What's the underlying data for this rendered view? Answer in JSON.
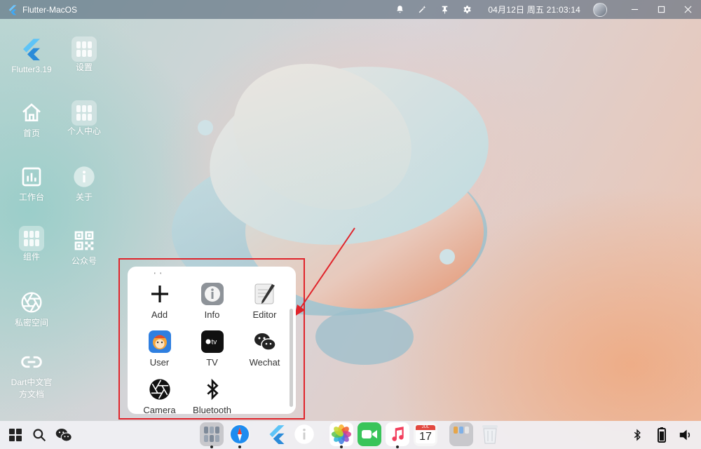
{
  "titlebar": {
    "app_title": "Flutter-MacOS",
    "clock": "04月12日 周五 21:03:14",
    "icons": [
      "bell-icon",
      "magic-wand-icon",
      "pin-icon",
      "settings-icon"
    ],
    "window_controls": [
      "minimize-icon",
      "maximize-icon",
      "close-icon"
    ]
  },
  "desktop": {
    "items": [
      {
        "label": "Flutter3.19",
        "icon": "flutter-logo-icon"
      },
      {
        "label": "设置",
        "icon": "settings-folder-icon"
      },
      {
        "label": "首页",
        "icon": "home-icon"
      },
      {
        "label": "个人中心",
        "icon": "profile-folder-icon"
      },
      {
        "label": "工作台",
        "icon": "dashboard-icon"
      },
      {
        "label": "关于",
        "icon": "info-icon"
      },
      {
        "label": "组件",
        "icon": "components-folder-icon"
      },
      {
        "label": "公众号",
        "icon": "qrcode-icon"
      },
      {
        "label": "私密空间",
        "icon": "aperture-icon"
      },
      {
        "label": "Dart中文官方文档",
        "icon": "link-icon"
      }
    ]
  },
  "popup": {
    "items": [
      {
        "label": "Add",
        "icon": "plus-icon"
      },
      {
        "label": "Info",
        "icon": "info-app-icon"
      },
      {
        "label": "Editor",
        "icon": "editor-pen-icon"
      },
      {
        "label": "User",
        "icon": "user-app-icon"
      },
      {
        "label": "TV",
        "icon": "apple-tv-icon"
      },
      {
        "label": "Wechat",
        "icon": "wechat-icon"
      },
      {
        "label": "Camera",
        "icon": "camera-aperture-icon"
      },
      {
        "label": "Bluetooth",
        "icon": "bluetooth-icon"
      }
    ]
  },
  "taskbar": {
    "left": [
      "windows-start-icon",
      "search-icon",
      "wechat-icon"
    ],
    "dock": [
      "launchpad-icon",
      "safari-icon",
      "flutter-icon",
      "info-icon",
      "photos-icon",
      "facetime-icon",
      "music-icon",
      "calendar-icon",
      "folder-icon",
      "trash-icon"
    ],
    "calendar": {
      "month": "JUL",
      "day": "17"
    },
    "right": [
      "bluetooth-icon",
      "battery-icon",
      "volume-icon"
    ]
  },
  "colors": {
    "annotation": "#e0242b",
    "titlebar": "#5a6f80",
    "taskbar": "#f0f0f4"
  }
}
